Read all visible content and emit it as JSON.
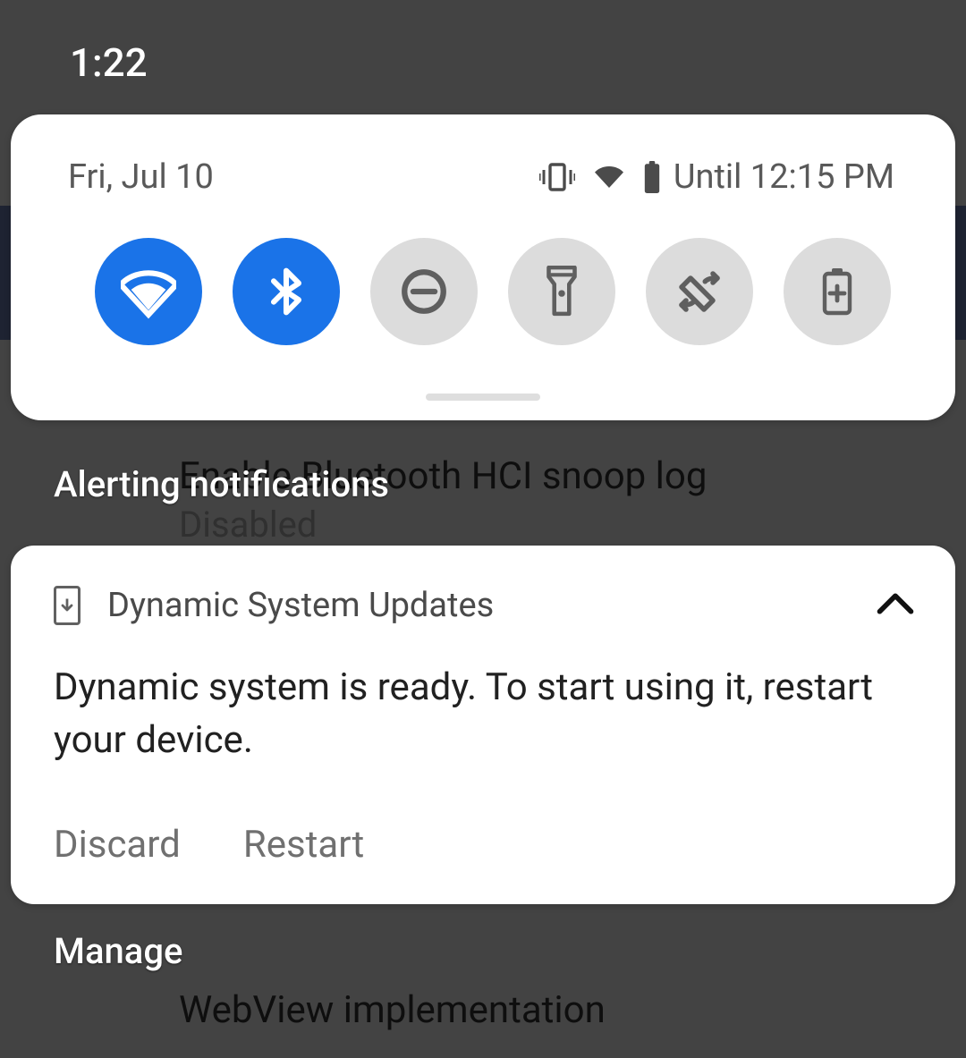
{
  "status": {
    "clock": "1:22"
  },
  "qs": {
    "date": "Fri, Jul 10",
    "until": "Until 12:15 PM",
    "tiles": [
      {
        "name": "wifi",
        "on": true
      },
      {
        "name": "bluetooth",
        "on": true
      },
      {
        "name": "do-not-disturb",
        "on": false
      },
      {
        "name": "flashlight",
        "on": false
      },
      {
        "name": "auto-rotate",
        "on": false
      },
      {
        "name": "battery-saver",
        "on": false
      }
    ]
  },
  "sections": {
    "alerting": "Alerting notifications",
    "manage": "Manage"
  },
  "notification": {
    "app": "Dynamic System Updates",
    "body": "Dynamic system is ready. To start using it, restart your device.",
    "actions": {
      "discard": "Discard",
      "restart": "Restart"
    }
  },
  "background": {
    "row1_title": "Enable Bluetooth HCI snoop log",
    "row1_sub": "Disabled",
    "row2_title": "WebView implementation"
  }
}
